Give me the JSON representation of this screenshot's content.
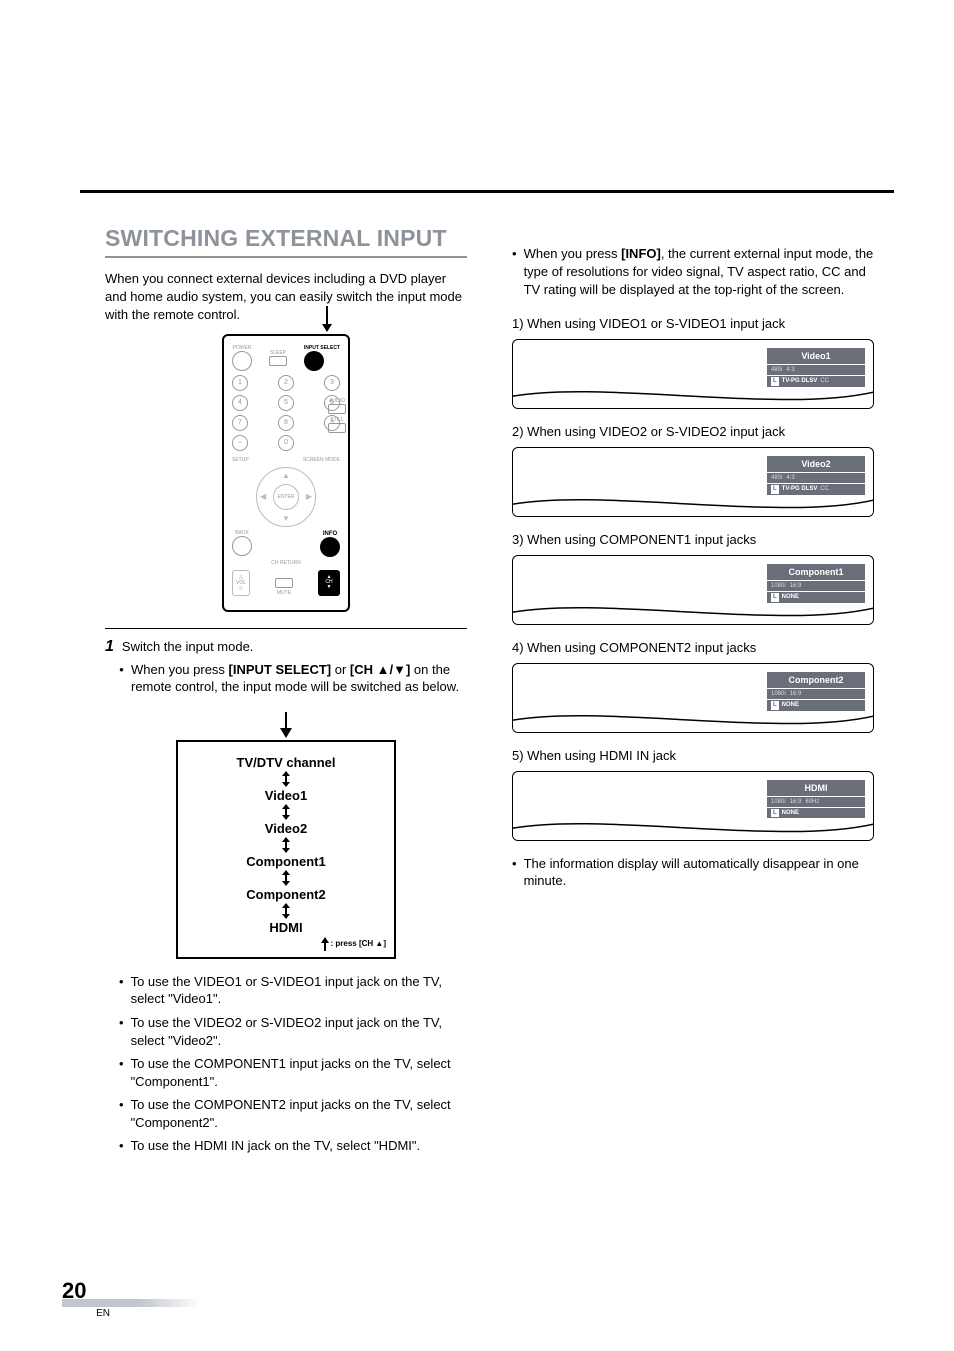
{
  "header": {
    "section_title": "SWITCHING EXTERNAL INPUT"
  },
  "intro": "When you connect external devices including a DVD player and home audio system, you can easily switch the input mode with the remote control.",
  "remote": {
    "power": "POWER",
    "sleep": "SLEEP",
    "input_select": "INPUT\nSELECT",
    "audio": "AUDIO",
    "still": "STILL",
    "setup": "SETUP",
    "screen_mode": "SCREEN\nMODE",
    "enter": "ENTER",
    "back": "BACK",
    "info": "INFO",
    "ch_return": "CH RETURN",
    "vol": "VOL",
    "mute": "MUTE",
    "ch": "CH"
  },
  "step1": {
    "num": "1",
    "text": "Switch the input mode.",
    "sub_bullet_prefix": "When you press ",
    "input_select_bold": "[INPUT SELECT]",
    "or_word": " or ",
    "ch_bold": "[CH ▲/▼]",
    "sub_bullet_suffix": " on the remote control, the input mode will be switched as below."
  },
  "flow": {
    "items": [
      "TV/DTV channel",
      "Video1",
      "Video2",
      "Component1",
      "Component2",
      "HDMI"
    ],
    "foot": ": press [CH ▲]"
  },
  "post_bullets": [
    "To use the VIDEO1 or S-VIDEO1 input jack on the TV, select \"Video1\".",
    "To use the VIDEO2 or S-VIDEO2 input jack on the TV, select \"Video2\".",
    "To use the COMPONENT1 input jacks on the TV, select \"Component1\".",
    "To use the COMPONENT2 input jacks on the TV, select \"Component2\".",
    "To use the HDMI IN jack on the TV, select \"HDMI\"."
  ],
  "right": {
    "info_bullet_prefix": "When you press ",
    "info_bold": "[INFO]",
    "info_bullet_suffix": ", the current external input mode, the type of resolutions for video signal, TV aspect ratio, CC and TV rating will be displayed at the top-right of the screen.",
    "cases": [
      {
        "label": "1) When using VIDEO1 or S-VIDEO1 input jack",
        "osd": {
          "line1": "Video1",
          "res": "480i",
          "aspect": "4:3",
          "prefix": "L",
          "rating": "TV-PG DLSV",
          "cc": "CC"
        }
      },
      {
        "label": "2) When using VIDEO2 or S-VIDEO2 input jack",
        "osd": {
          "line1": "Video2",
          "res": "480i",
          "aspect": "4:3",
          "prefix": "L",
          "rating": "TV-PG DLSV",
          "cc": "CC"
        }
      },
      {
        "label": "3) When using COMPONENT1 input jacks",
        "osd": {
          "line1": "Component1",
          "res": "1080i",
          "aspect": "16:9",
          "prefix": "L",
          "rating": "NONE",
          "cc": ""
        }
      },
      {
        "label": "4) When using COMPONENT2 input jacks",
        "osd": {
          "line1": "Component2",
          "res": "1080i",
          "aspect": "16:9",
          "prefix": "L",
          "rating": "NONE",
          "cc": ""
        }
      },
      {
        "label": "5) When using HDMI IN jack",
        "osd": {
          "line1": "HDMI",
          "res": "1080i",
          "aspect": "16:9",
          "prefix": "L",
          "rating": "NONE",
          "cc": "",
          "scan": "60Hz"
        }
      }
    ],
    "closing_bullet": "The information display will automatically disappear in one minute."
  },
  "page_footer": {
    "num": "20",
    "lang": "EN"
  }
}
